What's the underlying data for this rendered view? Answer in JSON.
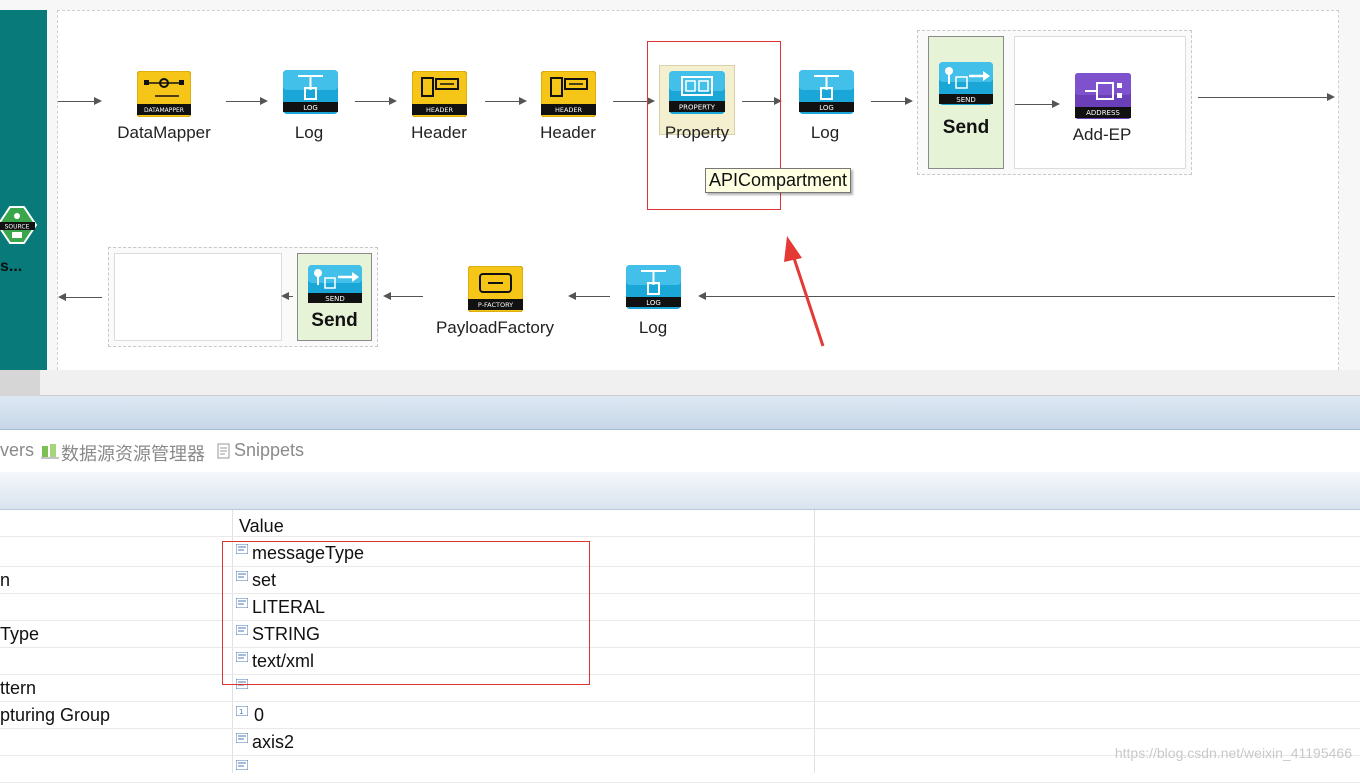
{
  "inbound": {
    "badge": "SOURCE",
    "label": "s..."
  },
  "flow": {
    "top_nodes": [
      {
        "label": "DataMapper",
        "badge": "DATAMAPPER",
        "icon": "datamapper-icon"
      },
      {
        "label": "Log",
        "badge": "LOG",
        "icon": "log-icon"
      },
      {
        "label": "Header",
        "badge": "HEADER",
        "icon": "header-icon"
      },
      {
        "label": "Header",
        "badge": "HEADER",
        "icon": "header-icon"
      },
      {
        "label": "Property",
        "badge": "PROPERTY",
        "icon": "property-icon"
      },
      {
        "label": "Log",
        "badge": "LOG",
        "icon": "log-icon"
      }
    ],
    "send_top": {
      "label": "Send",
      "badge": "SEND"
    },
    "endpoint": {
      "label": "Add-EP",
      "badge": "ADDRESS"
    },
    "tooltip": "APICompartment",
    "bottom_nodes": [
      {
        "label": "Log",
        "badge": "LOG",
        "icon": "log-icon"
      },
      {
        "label": "PayloadFactory",
        "badge": "P-FACTORY",
        "icon": "payload-factory-icon"
      }
    ],
    "send_bottom": {
      "label": "Send",
      "badge": "SEND"
    }
  },
  "view_tabs": [
    {
      "label": "vers"
    },
    {
      "label": "数据源资源管理器"
    },
    {
      "label": "Snippets"
    }
  ],
  "properties": {
    "value_header": "Value",
    "rows": [
      {
        "name": "",
        "value": "messageType"
      },
      {
        "name": "n",
        "value": "set"
      },
      {
        "name": "",
        "value": "LITERAL"
      },
      {
        "name": "Type",
        "value": "STRING"
      },
      {
        "name": "",
        "value": "text/xml"
      },
      {
        "name": "ttern",
        "value": ""
      },
      {
        "name": "pturing Group",
        "value": "0"
      },
      {
        "name": "",
        "value": "axis2"
      },
      {
        "name": "",
        "value": ""
      }
    ]
  },
  "watermark": "https://blog.csdn.net/weixin_41195466",
  "colors": {
    "left_bar": "#087a7a",
    "send_bg": "#e6f3d6",
    "property_bg": "#f4efcf",
    "annotation_red": "#e53935"
  }
}
